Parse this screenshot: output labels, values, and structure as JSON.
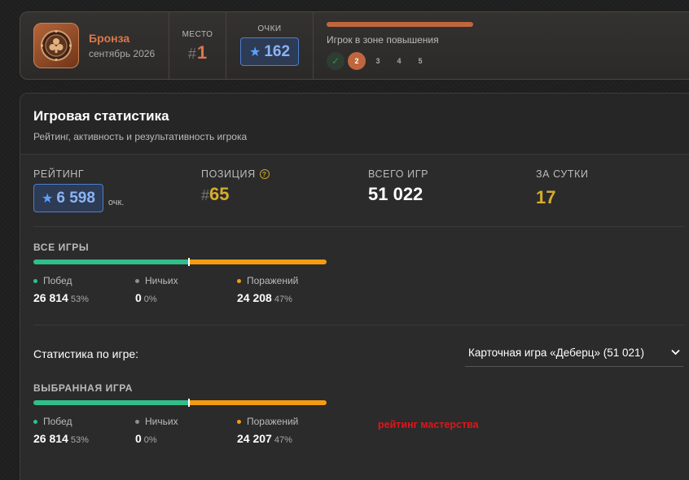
{
  "league": {
    "name": "Бронза",
    "date": "сентябрь 2026",
    "place_label": "МЕСТО",
    "place_hash": "#",
    "place_value": "1",
    "points_label": "ОЧКИ",
    "points_value": "162",
    "promo_text": "Игрок в зоне повышения",
    "promo_progress": 1.0,
    "steps": [
      "✓",
      "2",
      "3",
      "4",
      "5"
    ],
    "colors": {
      "accent": "#d9784a",
      "bar": "#c0663e"
    }
  },
  "stats": {
    "title": "Игровая статистика",
    "subtitle": "Рейтинг, активность и результативность игрока",
    "rating_label": "РЕЙТИНГ",
    "rating_value": "6 598",
    "rating_unit": "очк.",
    "position_label": "ПОЗИЦИЯ",
    "position_hash": "#",
    "position_value": "65",
    "total_label": "ВСЕГО ИГР",
    "total_value": "51 022",
    "day_label": "ЗА СУТКИ",
    "day_value": "17",
    "all_games": {
      "label": "ВСЕ ИГРЫ",
      "win_share": 0.53,
      "draw_share": 0.0,
      "loss_share": 0.47,
      "wins_label": "Побед",
      "wins": "26 814",
      "wins_pct": "53%",
      "draws_label": "Ничьих",
      "draws": "0",
      "draws_pct": "0%",
      "losses_label": "Поражений",
      "losses": "24 208",
      "losses_pct": "47%"
    },
    "per_game_label": "Статистика по игре:",
    "selected_game_option": "Карточная игра «Деберц» (51 021)",
    "selected_game": {
      "label": "ВЫБРАННАЯ ИГРА",
      "win_share": 0.53,
      "draw_share": 0.0,
      "loss_share": 0.47,
      "wins_label": "Побед",
      "wins": "26 814",
      "wins_pct": "53%",
      "draws_label": "Ничьих",
      "draws": "0",
      "draws_pct": "0%",
      "losses_label": "Поражений",
      "losses": "24 207",
      "losses_pct": "47%"
    },
    "annotation": "рейтинг мастерства",
    "icons": {
      "star": "star-icon",
      "help": "question-circle-icon",
      "chevron": "chevron-down-icon"
    },
    "colors": {
      "win": "#2fc08a",
      "draw": "#8a8f99",
      "loss": "#f39c12",
      "rating": "#8ab4f5",
      "gold": "#d7ad2e"
    }
  }
}
